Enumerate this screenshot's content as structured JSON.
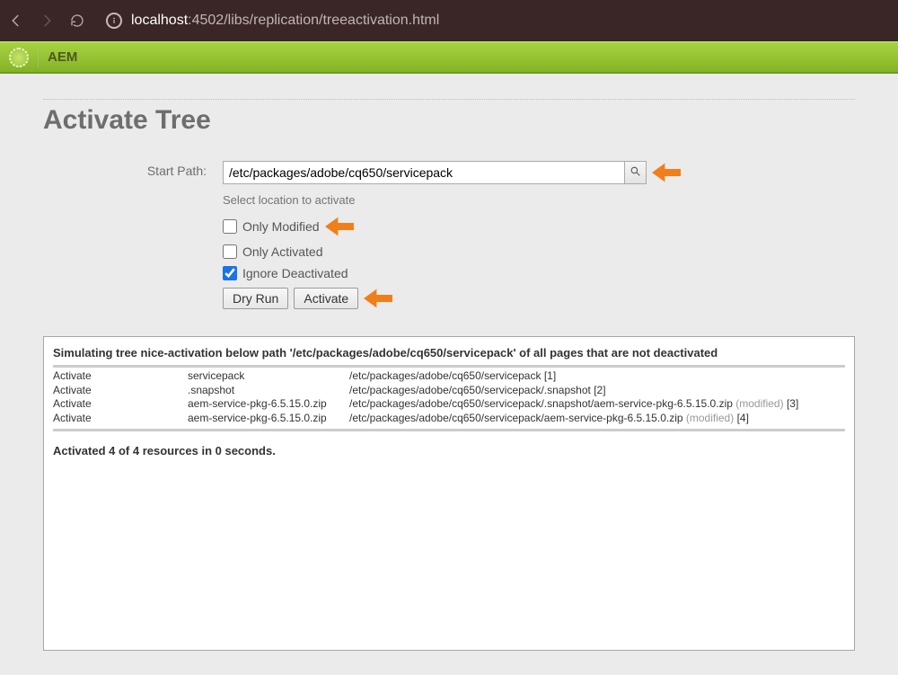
{
  "browser": {
    "url_host": "localhost",
    "url_port": ":4502",
    "url_path": "/libs/replication/treeactivation.html"
  },
  "header": {
    "app_name": "AEM"
  },
  "page": {
    "title": "Activate Tree",
    "start_path_label": "Start Path:",
    "start_path_value": "/etc/packages/adobe/cq650/servicepack",
    "help_text": "Select location to activate",
    "checkboxes": {
      "only_modified": {
        "label": "Only Modified",
        "checked": false
      },
      "only_activated": {
        "label": "Only Activated",
        "checked": false
      },
      "ignore_deactivated": {
        "label": "Ignore Deactivated",
        "checked": true
      }
    },
    "buttons": {
      "dry_run": "Dry Run",
      "activate": "Activate"
    }
  },
  "results": {
    "heading": "Simulating tree nice-activation below path '/etc/packages/adobe/cq650/servicepack' of all pages that are not deactivated",
    "rows": [
      {
        "action": "Activate",
        "name": "servicepack",
        "path": "/etc/packages/adobe/cq650/servicepack",
        "modified": false,
        "idx": "[1]"
      },
      {
        "action": "Activate",
        "name": ".snapshot",
        "path": "/etc/packages/adobe/cq650/servicepack/.snapshot",
        "modified": false,
        "idx": "[2]"
      },
      {
        "action": "Activate",
        "name": "aem-service-pkg-6.5.15.0.zip",
        "path": "/etc/packages/adobe/cq650/servicepack/.snapshot/aem-service-pkg-6.5.15.0.zip",
        "modified": true,
        "idx": "[3]"
      },
      {
        "action": "Activate",
        "name": "aem-service-pkg-6.5.15.0.zip",
        "path": "/etc/packages/adobe/cq650/servicepack/aem-service-pkg-6.5.15.0.zip",
        "modified": true,
        "idx": "[4]"
      }
    ],
    "modified_label": "(modified)",
    "summary": "Activated 4 of 4 resources in 0 seconds."
  }
}
